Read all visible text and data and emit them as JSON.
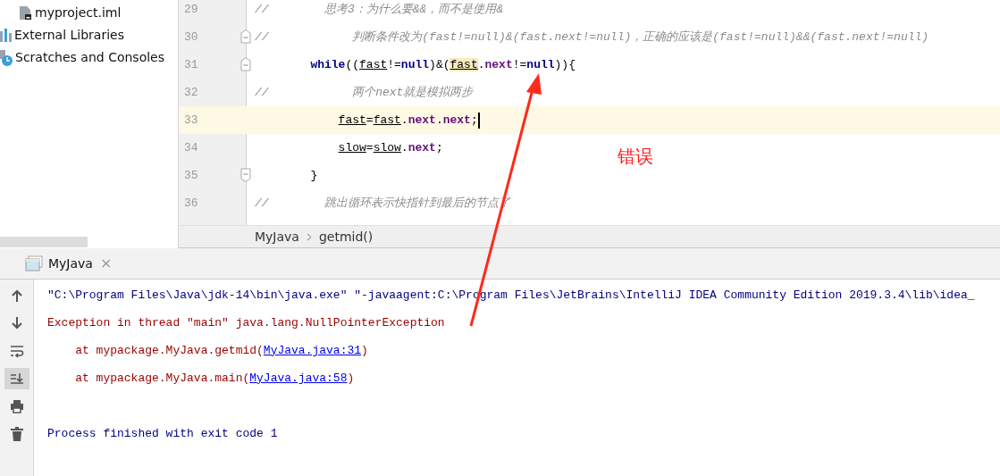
{
  "project_tree": [
    {
      "label": "myproject.iml",
      "kind": "file"
    },
    {
      "label": "External Libraries",
      "kind": "library"
    },
    {
      "label": "Scratches and Consoles",
      "kind": "scratches"
    }
  ],
  "editor": {
    "lines": [
      {
        "number": "29",
        "fold_start": false,
        "fold_end": false,
        "current": false,
        "segments": [
          {
            "text": "//        思考3：为什么要&&，而不是使用&",
            "kind": "comment"
          }
        ]
      },
      {
        "number": "30",
        "fold_start": true,
        "fold_end": false,
        "current": false,
        "segments": [
          {
            "text": "//            判断条件改为(fast!=null)&(fast.next!=null)，正确的应该是(fast!=null)&&(fast.next!=null)",
            "kind": "comment"
          }
        ]
      },
      {
        "number": "31",
        "fold_start": true,
        "fold_end": false,
        "current": false,
        "segments": [
          {
            "text": "while",
            "kind": "keyword"
          },
          {
            "text": "((",
            "kind": "plain"
          },
          {
            "text": "fast",
            "kind": "var"
          },
          {
            "text": "!=",
            "kind": "plain"
          },
          {
            "text": "null",
            "kind": "keyword"
          },
          {
            "text": ")&(",
            "kind": "plain"
          },
          {
            "text": "fast",
            "kind": "var-highlight"
          },
          {
            "text": ".",
            "kind": "plain"
          },
          {
            "text": "next",
            "kind": "field"
          },
          {
            "text": "!=",
            "kind": "plain"
          },
          {
            "text": "null",
            "kind": "keyword"
          },
          {
            "text": ")){",
            "kind": "plain"
          }
        ],
        "children": [
          {
            "number": "32",
            "fold_start": false,
            "fold_end": false,
            "current": false,
            "segments": [
              {
                "text": "//            两个next就是模拟两步",
                "kind": "comment"
              }
            ]
          },
          {
            "number": "33",
            "fold_start": false,
            "fold_end": false,
            "current": true,
            "segments": [
              {
                "text": "fast",
                "kind": "var"
              },
              {
                "text": "=",
                "kind": "plain"
              },
              {
                "text": "fast",
                "kind": "var"
              },
              {
                "text": ".",
                "kind": "plain"
              },
              {
                "text": "next",
                "kind": "field"
              },
              {
                "text": ".",
                "kind": "plain"
              },
              {
                "text": "next",
                "kind": "field"
              },
              {
                "text": ";",
                "kind": "plain"
              }
            ]
          },
          {
            "number": "34",
            "fold_start": false,
            "fold_end": false,
            "current": false,
            "segments": [
              {
                "text": "slow",
                "kind": "var"
              },
              {
                "text": "=",
                "kind": "plain"
              },
              {
                "text": "slow",
                "kind": "var"
              },
              {
                "text": ".",
                "kind": "plain"
              },
              {
                "text": "next",
                "kind": "field"
              },
              {
                "text": ";",
                "kind": "plain"
              }
            ]
          }
        ]
      },
      {
        "number": "35",
        "fold_start": false,
        "fold_end": true,
        "current": false,
        "segments": [
          {
            "text": "}",
            "kind": "plain"
          }
        ]
      },
      {
        "number": "36",
        "fold_start": false,
        "fold_end": false,
        "current": false,
        "segments": [
          {
            "text": "//        跳出循环表示快指针到最后的节点了",
            "kind": "comment"
          }
        ]
      }
    ]
  },
  "breadcrumb": [
    "MyJava",
    "getmid()"
  ],
  "tool_tab": {
    "label": "MyJava",
    "close": "×"
  },
  "console_toolbar": [
    {
      "kind": "up",
      "on": false
    },
    {
      "kind": "down",
      "on": false
    },
    {
      "kind": "wrap",
      "on": false
    },
    {
      "kind": "scroll-end",
      "on": true
    },
    {
      "kind": "print",
      "on": false
    },
    {
      "kind": "delete",
      "on": false
    }
  ],
  "console": [
    {
      "kind": "command",
      "segments": [
        {
          "text": "\"C:\\Program Files\\Java\\jdk-14\\bin\\java.exe\" \"-javaagent:C:\\Program Files\\JetBrains\\IntelliJ IDEA Community Edition 2019.3.4\\lib\\idea_",
          "kind": "plain"
        }
      ]
    },
    {
      "kind": "error",
      "segments": [
        {
          "text": "Exception in thread \"main\" java.lang.NullPointerException",
          "kind": "plain"
        }
      ]
    },
    {
      "kind": "error",
      "segments": [
        {
          "text": "    at mypackage.MyJava.getmid(",
          "kind": "plain"
        },
        {
          "text": "MyJava.java:31",
          "kind": "link"
        },
        {
          "text": ")",
          "kind": "plain"
        }
      ]
    },
    {
      "kind": "error",
      "segments": [
        {
          "text": "    at mypackage.MyJava.main(",
          "kind": "plain"
        },
        {
          "text": "MyJava.java:58",
          "kind": "link"
        },
        {
          "text": ")",
          "kind": "plain"
        }
      ]
    },
    {
      "kind": "blank"
    },
    {
      "kind": "info",
      "segments": [
        {
          "text": "Process finished with exit code 1",
          "kind": "plain"
        }
      ]
    }
  ],
  "annotation": {
    "text": "错误"
  }
}
